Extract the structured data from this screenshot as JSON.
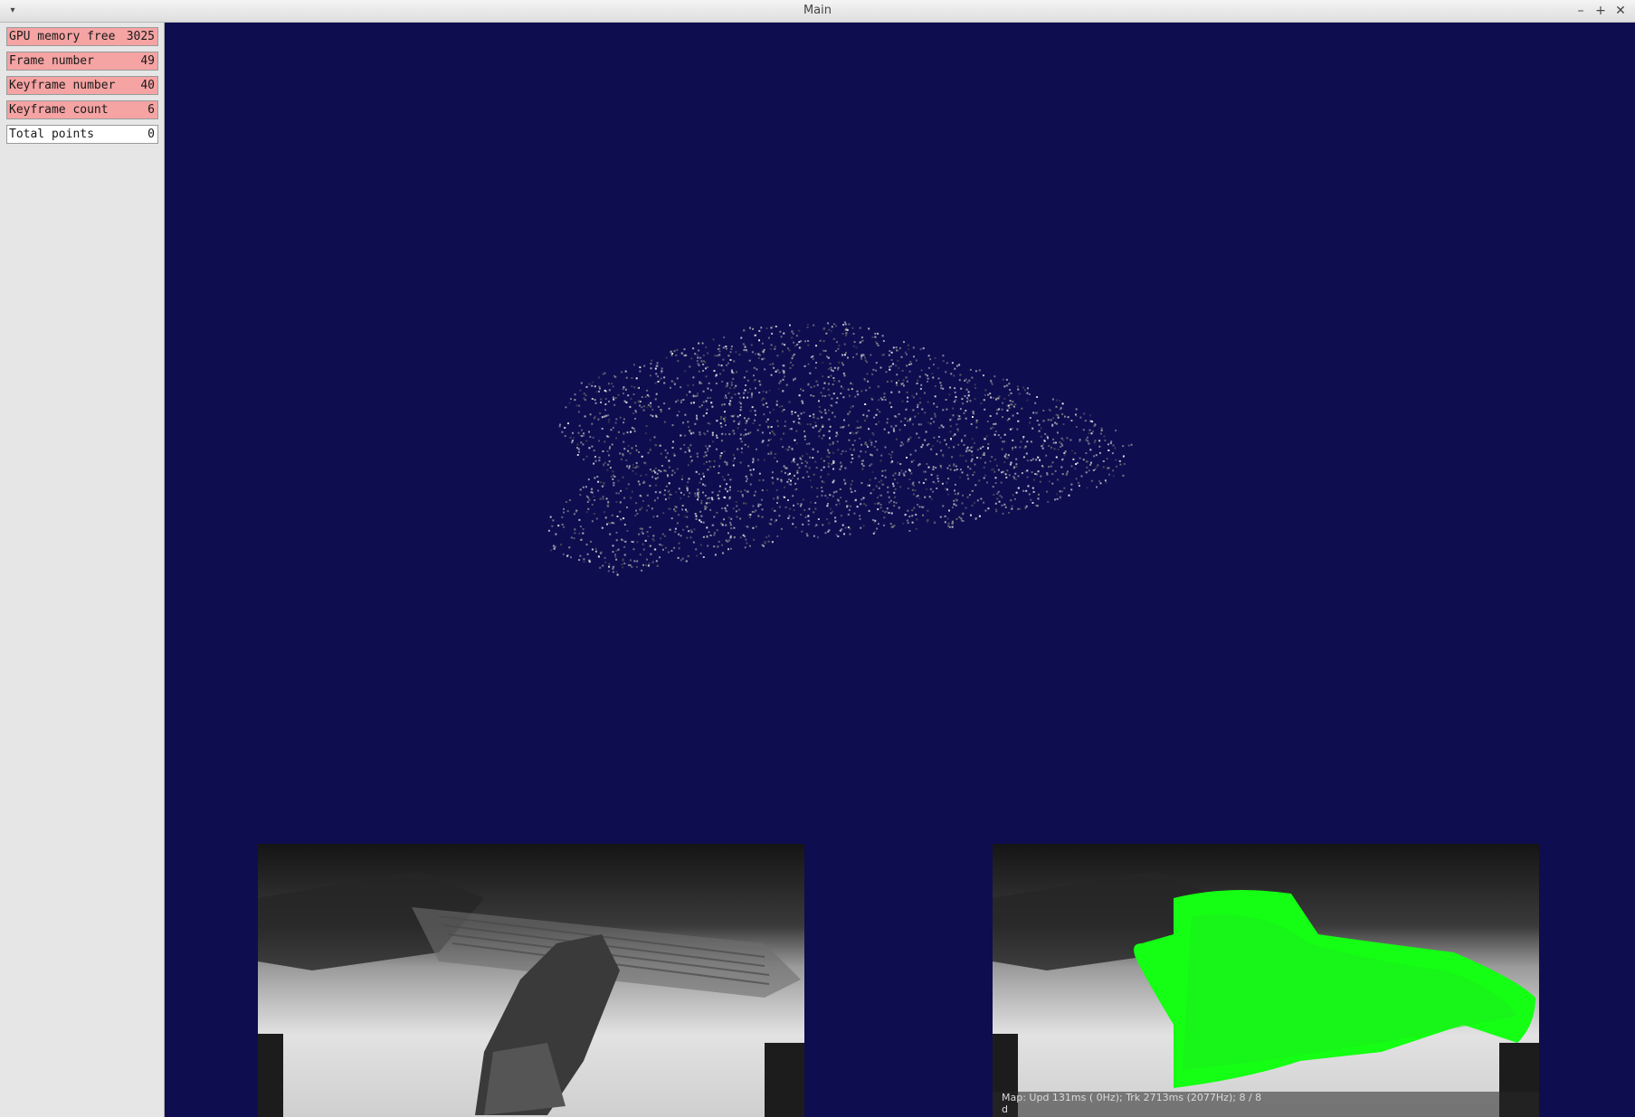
{
  "window": {
    "title": "Main"
  },
  "panel": {
    "rows": [
      {
        "label": "GPU memory free",
        "value": "3025",
        "state": "warn"
      },
      {
        "label": "Frame number",
        "value": "49",
        "state": "warn"
      },
      {
        "label": "Keyframe number",
        "value": "40",
        "state": "warn"
      },
      {
        "label": "Keyframe count",
        "value": "6",
        "state": "warn"
      },
      {
        "label": "Total points",
        "value": "0",
        "state": "ok"
      }
    ]
  },
  "viewport": {
    "background_color": "#0e0d50",
    "point_cloud_color": "#c8c8c8"
  },
  "feeds": {
    "left": {
      "kind": "grayscale-camera"
    },
    "right": {
      "kind": "depth-overlay",
      "overlay_color": "#00ff00",
      "status_line1": "Map: Upd 131ms ( 0Hz); Trk 2713ms (2077Hz); 8 / 8",
      "status_line2": "d"
    }
  }
}
